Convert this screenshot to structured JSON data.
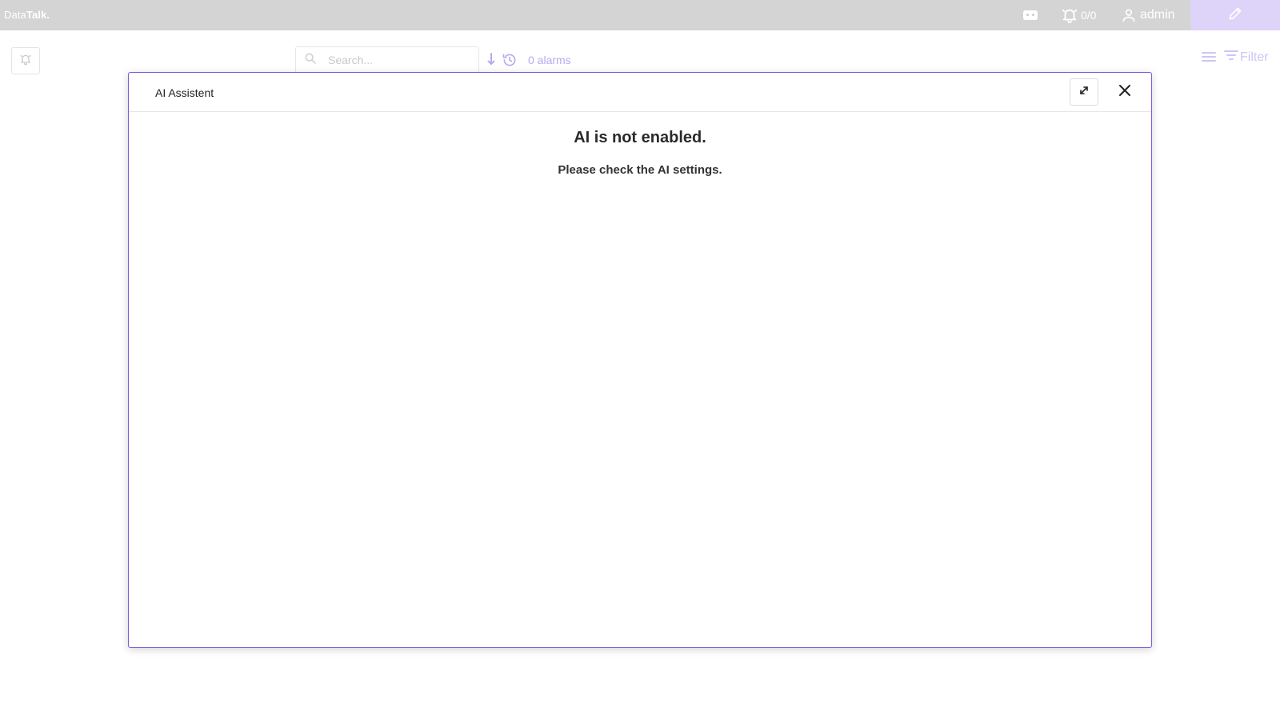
{
  "topbar": {
    "logo_light": "Data",
    "logo_strong": "Talk.",
    "alarm_counter": "0/0",
    "username": "admin"
  },
  "toolbar": {
    "search_placeholder": "Search...",
    "alarm_count": "0 alarms",
    "filter_label": "Filter"
  },
  "dialog": {
    "title": "AI Assistent",
    "heading": "AI is not enabled.",
    "message": "Please check the AI settings."
  },
  "colors": {
    "topbar_bg": "#d4d4d4",
    "accent": "#7d5bd9",
    "edit_bg": "#ded3f8"
  }
}
